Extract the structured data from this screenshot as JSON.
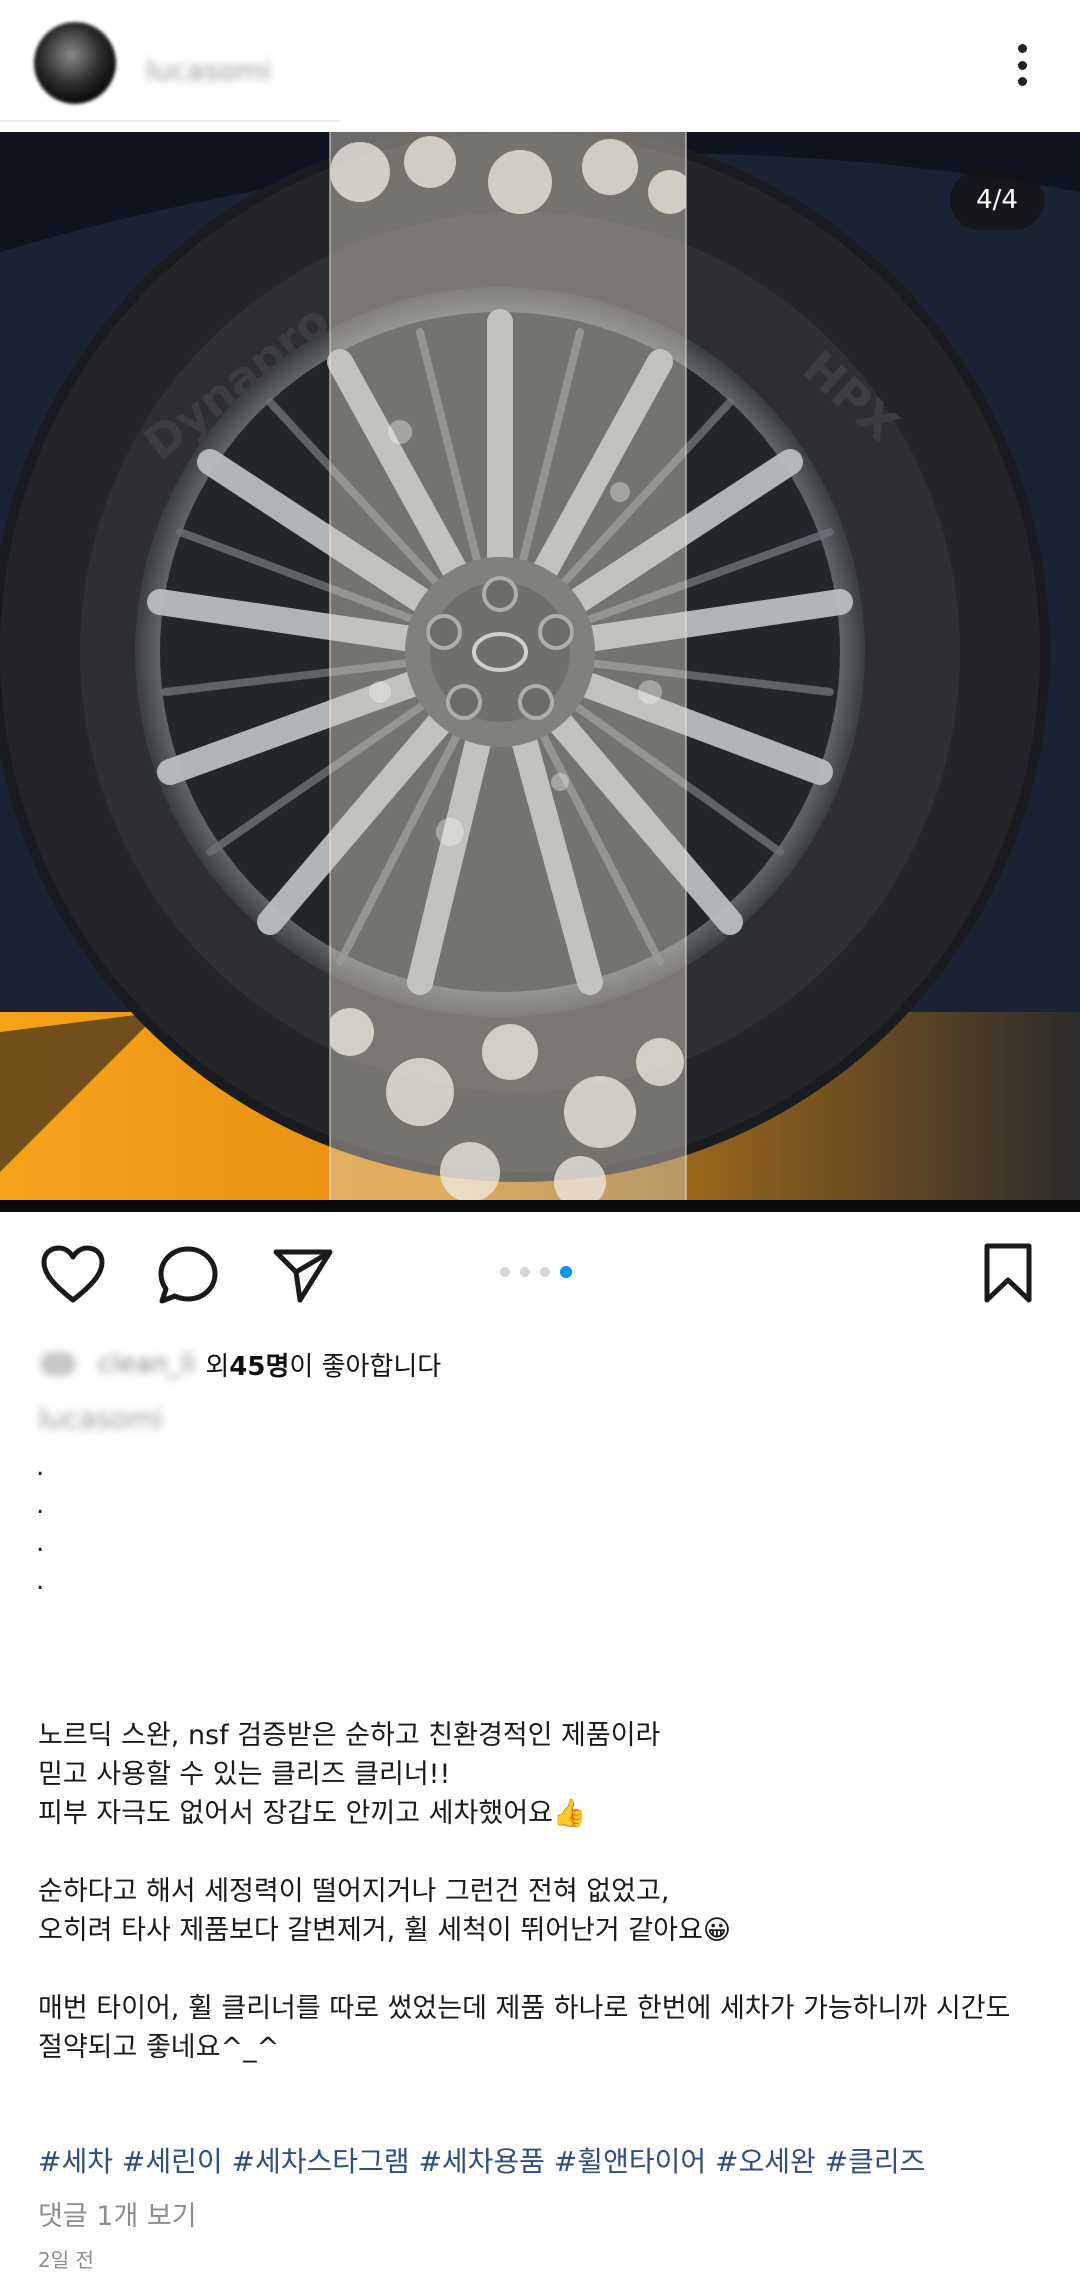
{
  "header": {
    "username": "lucasomi",
    "more_icon": "more-vertical-icon"
  },
  "post": {
    "counter": "4/4",
    "image_description_icon": "car-wheel-photo"
  },
  "actions": {
    "like_icon": "heart-icon",
    "comment_icon": "comment-icon",
    "share_icon": "send-icon",
    "save_icon": "bookmark-icon",
    "carousel_total": 4,
    "carousel_active": 4,
    "accent_color": "#0095f6"
  },
  "likes": {
    "liker": "clean_li",
    "prefix": " 외 ",
    "count": "45명",
    "suffix": "이 좋아합니다"
  },
  "caption": {
    "username": "lucasomi",
    "dot_lines": [
      ".",
      ".",
      ".",
      "."
    ],
    "lines": [
      "노르딕 스완, nsf 검증받은 순하고 친환경적인 제품이라",
      "믿고 사용할 수 있는 클리즈 클리너!!",
      "피부 자극도 없어서 장갑도 안끼고 세차했어요👍",
      "",
      "순하다고 해서 세정력이 떨어지거나 그런건 전혀 없었고,",
      "오히려 타사 제품보다 갈변제거, 휠 세척이 뛰어난거 같아요😀",
      "",
      "매번 타이어, 휠 클리너를 따로 썼었는데 제품 하나로 한번에 세차가 가능하니까 시간도",
      "절약되고 좋네요^_^"
    ]
  },
  "hashtags": "#세차 #세린이 #세차스타그램 #세차용품 #휠앤타이어 #오세완 #클리즈",
  "comments_link": "댓글 1개 보기",
  "timestamp": "2일 전"
}
